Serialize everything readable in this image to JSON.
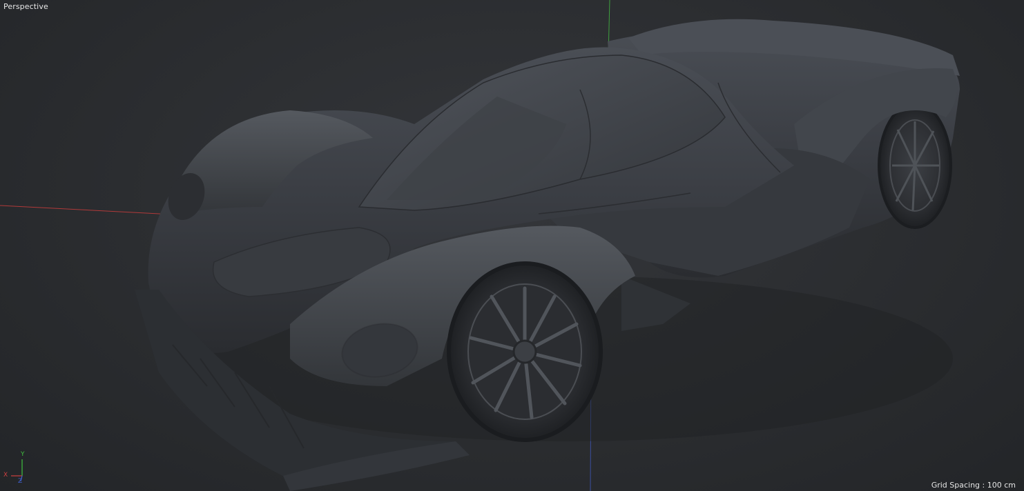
{
  "viewport": {
    "camera_label": "Perspective",
    "grid_spacing_label": "Grid Spacing : 100 cm"
  },
  "axis_gizmo": {
    "x_label": "X",
    "y_label": "Y",
    "z_label": "Z",
    "x_color": "#d04040",
    "y_color": "#3fbf3f",
    "z_color": "#4060d0"
  },
  "model": {
    "icon": "car-model-icon",
    "base_color": "#3a3d42"
  }
}
